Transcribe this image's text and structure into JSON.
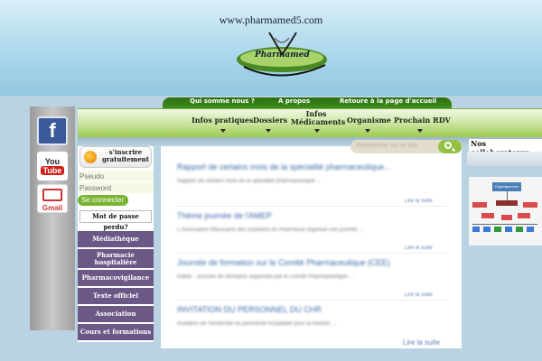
{
  "header": {
    "site_url": "www.pharmamed5.com",
    "logo_text": "Pharmamed"
  },
  "social": {
    "facebook": "f",
    "youtube_you": "You",
    "youtube_tube": "Tube",
    "gmail": "Gmail"
  },
  "nav_top": [
    "Qui somme nous ?",
    "A propos",
    "Retoure à la page d'accueil"
  ],
  "nav_main": [
    {
      "label": "Infos pratiques"
    },
    {
      "label": "Dossiers"
    },
    {
      "label_line1": "Infos",
      "label_line2": "Médicaments"
    },
    {
      "label": "Organisme"
    },
    {
      "label": "Prochain RDV"
    }
  ],
  "login": {
    "signup_line1": "s'inscrire",
    "signup_line2": "gratuitement",
    "pseudo_placeholder": "Pseudo",
    "password_placeholder": "Password",
    "connect_label": "Se connecter",
    "forgot_label": "Mot de passe perdu?"
  },
  "side_menu": [
    "Médiathèque",
    "Pharmacie hospitalière",
    "Pharmacovigilance",
    "Texte officiel",
    "Association",
    "Cours et formations"
  ],
  "search": {
    "placeholder": "Rechercher sur le site"
  },
  "articles": [
    {
      "title": "Rapport de certains mois de la spécialité pharmaceutique...",
      "text": "Rapport de certains mois de la spécialité pharmaceutique ...",
      "more": "Lire la suite"
    },
    {
      "title": "Thème journée de l'AMEP",
      "text": "L'Association Marocaine des Etudiants en Pharmacie organise une journée ...",
      "more": "Lire la suite"
    },
    {
      "title": "Journée de formation sur le Comité Pharmaceutique (CEE)",
      "text": "Rabat - Journée de formation organisée par le Comité Pharmaceutique ...",
      "more": "Lire la suite"
    },
    {
      "title": "INVITATION DU PERSONNEL DU CHR",
      "text": "Invitation de l'ensemble du personnel hospitalier pour la réunion ...",
      "more": ""
    }
  ],
  "read_more": "Lire la suite",
  "right": {
    "title": "Nos collaborateurs",
    "org_label": "Organigramme"
  }
}
